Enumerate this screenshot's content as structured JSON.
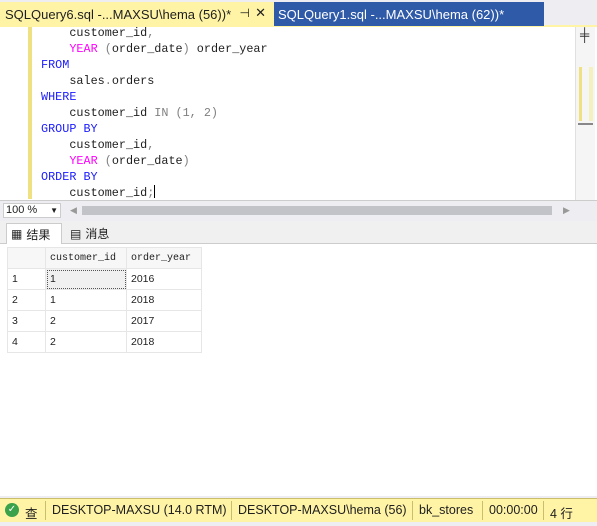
{
  "tabs": [
    {
      "label": "SQLQuery6.sql -...MAXSU\\hema (56))*",
      "active": true
    },
    {
      "label": "SQLQuery1.sql -...MAXSU\\hema (62))*",
      "active": false
    }
  ],
  "editor": {
    "lines": [
      {
        "indent": "    ",
        "parts": [
          {
            "t": "customer_id",
            "c": ""
          },
          {
            "t": ",",
            "c": "gr"
          }
        ]
      },
      {
        "indent": "    ",
        "parts": [
          {
            "t": "YEAR",
            "c": "fn"
          },
          {
            "t": " (",
            "c": "gr"
          },
          {
            "t": "order_date",
            "c": ""
          },
          {
            "t": ")",
            "c": "gr"
          },
          {
            "t": " order_year",
            "c": ""
          }
        ]
      },
      {
        "indent": "",
        "parts": [
          {
            "t": "FROM",
            "c": "kw"
          }
        ]
      },
      {
        "indent": "    ",
        "parts": [
          {
            "t": "sales",
            "c": ""
          },
          {
            "t": ".",
            "c": "gr"
          },
          {
            "t": "orders",
            "c": ""
          }
        ]
      },
      {
        "indent": "",
        "parts": [
          {
            "t": "WHERE",
            "c": "kw"
          }
        ]
      },
      {
        "indent": "    ",
        "parts": [
          {
            "t": "customer_id",
            "c": ""
          },
          {
            "t": " IN (1, 2)",
            "c": "gr"
          }
        ]
      },
      {
        "indent": "",
        "parts": [
          {
            "t": "GROUP BY",
            "c": "kw"
          }
        ]
      },
      {
        "indent": "    ",
        "parts": [
          {
            "t": "customer_id",
            "c": ""
          },
          {
            "t": ",",
            "c": "gr"
          }
        ]
      },
      {
        "indent": "    ",
        "parts": [
          {
            "t": "YEAR",
            "c": "fn"
          },
          {
            "t": " (",
            "c": "gr"
          },
          {
            "t": "order_date",
            "c": ""
          },
          {
            "t": ")",
            "c": "gr"
          }
        ]
      },
      {
        "indent": "",
        "parts": [
          {
            "t": "ORDER BY",
            "c": "kw"
          }
        ]
      },
      {
        "indent": "    ",
        "parts": [
          {
            "t": "customer_id",
            "c": ""
          },
          {
            "t": ";",
            "c": "gr"
          }
        ],
        "caret": true
      }
    ]
  },
  "zoom": {
    "value": "100 %"
  },
  "result_tabs": {
    "results": "结果",
    "messages": "消息"
  },
  "grid": {
    "columns": [
      "customer_id",
      "order_year"
    ],
    "rows": [
      {
        "n": "1",
        "cells": [
          "1",
          "2016"
        ]
      },
      {
        "n": "2",
        "cells": [
          "1",
          "2018"
        ]
      },
      {
        "n": "3",
        "cells": [
          "2",
          "2017"
        ]
      },
      {
        "n": "4",
        "cells": [
          "2",
          "2018"
        ]
      }
    ]
  },
  "status": {
    "state": "查",
    "server": "DESKTOP-MAXSU (14.0 RTM)",
    "login": "DESKTOP-MAXSU\\hema (56)",
    "database": "bk_stores",
    "elapsed": "00:00:00",
    "rows": "4 行"
  },
  "colors": {
    "accent": "#fff3a6",
    "inactive_tab": "#2f5aa8",
    "keyword": "#1a1aff",
    "function": "#ff00ff"
  }
}
